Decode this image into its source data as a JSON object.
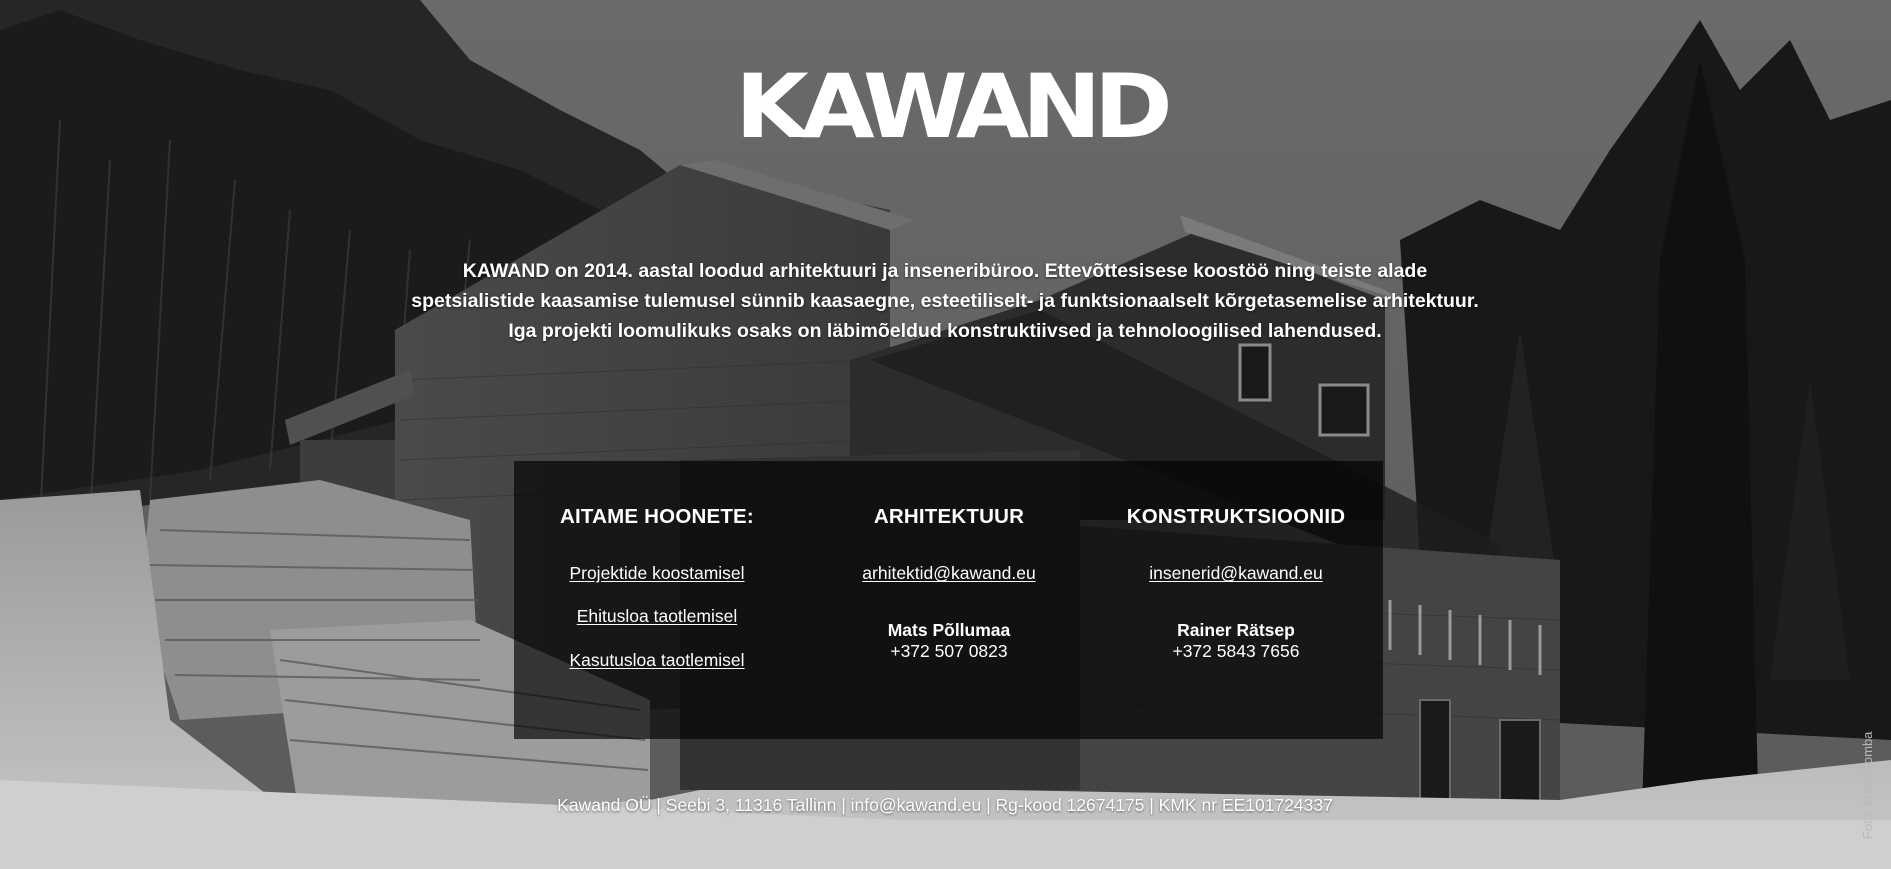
{
  "brand": {
    "logo_text": "KAWAND"
  },
  "intro": {
    "lines": [
      "KAWAND on 2014. aastal loodud arhitektuuri ja inseneribüroo. Ettevõttesisese koostöö ning teiste alade",
      "spetsialistide kaasamise tulemusel sünnib kaasaegne, esteetiliselt- ja funktsionaalselt kõrgetasemelise arhitektuur.",
      "Iga projekti loomulikuks osaks on läbimõeldud konstruktiivsed ja tehnoloogilised lahendused."
    ]
  },
  "panel": {
    "services": {
      "title": "AITAME HOONETE:",
      "links": [
        "Projektide koostamisel",
        "Ehitusloa taotlemisel",
        "Kasutusloa taotlemisel"
      ]
    },
    "architecture": {
      "title": "ARHITEKTUUR",
      "email": "arhitektid@kawand.eu",
      "contact_name": "Mats Põllumaa",
      "contact_phone": "+372 507 0823"
    },
    "structures": {
      "title": "KONSTRUKTSIOONID",
      "email": "insenerid@kawand.eu",
      "contact_name": "Rainer Rätsep",
      "contact_phone": "+372 5843 7656"
    }
  },
  "footer": {
    "text": "Kawand OÜ | Seebi 3, 11316 Tallinn | info@kawand.eu | Rg-kood 12674175 | KMK nr EE101724337"
  },
  "photo_credit": "Foto: Maris Tomba",
  "colors": {
    "text": "#ffffff",
    "panel_background": "#000000",
    "credit_text": "#b9b9b9"
  }
}
